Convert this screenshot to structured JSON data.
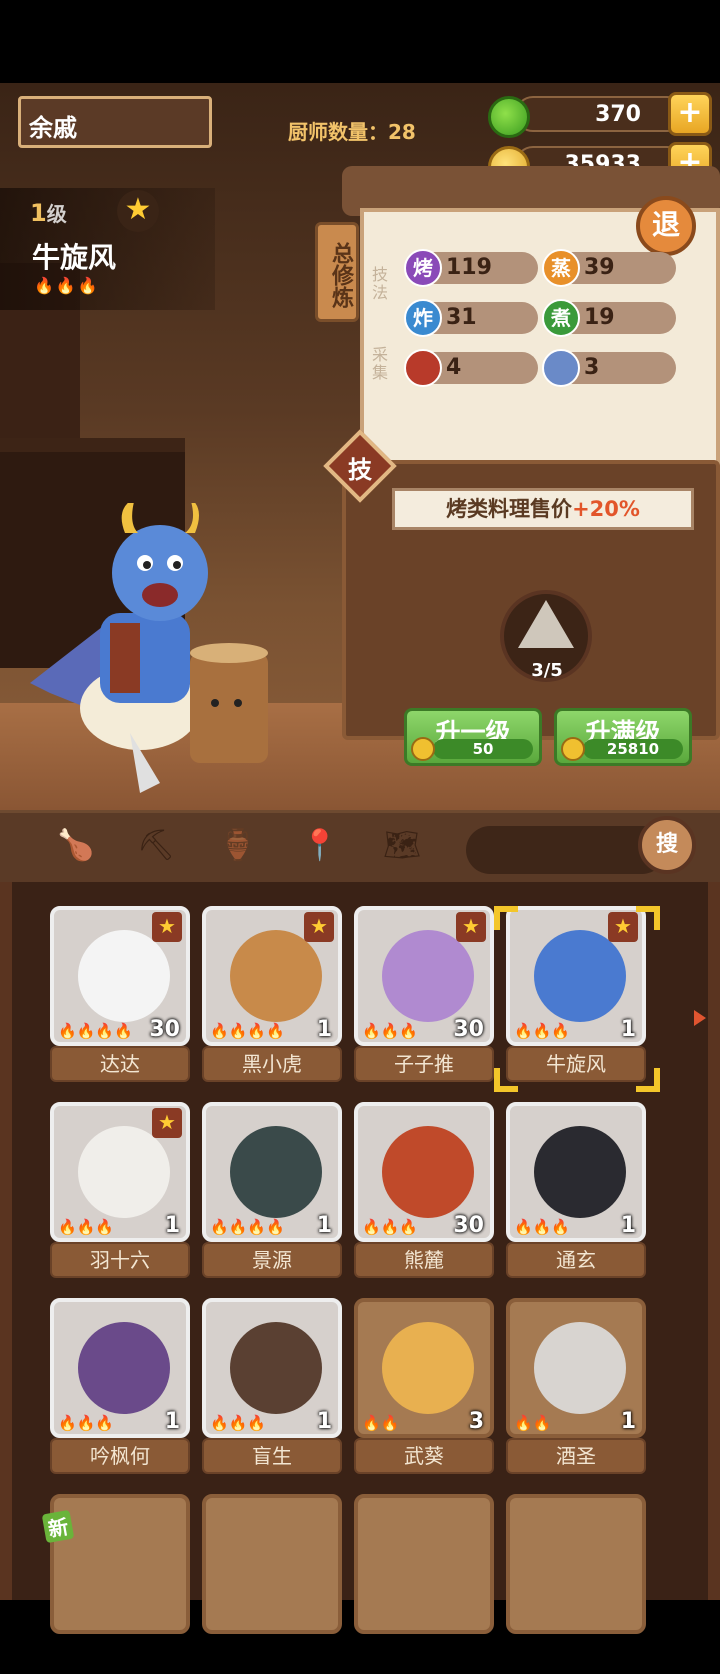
{
  "header": {
    "player_name": "余戚",
    "chef_count_label": "厨师数量：28",
    "jade": "370",
    "coins": "35933",
    "plus_label": "+"
  },
  "character": {
    "level_num": "1",
    "level_unit": "级",
    "name": "牛旋风",
    "flames": "🔥🔥🔥"
  },
  "panel": {
    "side_tag": "总修炼",
    "exit_label": "退",
    "skill_label": "技法",
    "gather_label": "采集",
    "skills": [
      {
        "icon": "烤",
        "value": "119",
        "color": "#8a4ab8"
      },
      {
        "icon": "蒸",
        "value": "39",
        "color": "#e8902a"
      },
      {
        "icon": "炸",
        "value": "31",
        "color": "#3a8ad0"
      },
      {
        "icon": "煮",
        "value": "19",
        "color": "#3a9a3a"
      }
    ],
    "gather": [
      {
        "icon": "meat-icon",
        "value": "4"
      },
      {
        "icon": "fish-icon",
        "value": "3"
      }
    ],
    "tech_label": "技",
    "bonus_text": "烤类料理售价",
    "bonus_pct": "+20%",
    "unlock_progress": "3/5",
    "upgrade_one_label": "升一级",
    "upgrade_one_cost": "50",
    "upgrade_max_label": "升满级",
    "upgrade_max_cost": "25810"
  },
  "filters": {
    "icons": [
      "drumstick-icon",
      "shovel-icon",
      "jar-icon",
      "location-icon",
      "map-question-icon"
    ],
    "search_label": "搜"
  },
  "chefs": [
    {
      "name": "达达",
      "level": "30",
      "flames": "🔥🔥🔥🔥",
      "star": true,
      "color": "#f4f4f4"
    },
    {
      "name": "黑小虎",
      "level": "1",
      "flames": "🔥🔥🔥🔥",
      "star": true,
      "color": "#c88a4a"
    },
    {
      "name": "子子推",
      "level": "30",
      "flames": "🔥🔥🔥",
      "star": true,
      "color": "#b08ad0"
    },
    {
      "name": "牛旋风",
      "level": "1",
      "flames": "🔥🔥🔥",
      "star": true,
      "color": "#4a7ad0"
    },
    {
      "name": "羽十六",
      "level": "1",
      "flames": "🔥🔥🔥",
      "star": true,
      "color": "#f0eeea"
    },
    {
      "name": "景源",
      "level": "1",
      "flames": "🔥🔥🔥🔥",
      "star": false,
      "color": "#3a4a4a"
    },
    {
      "name": "熊麓",
      "level": "30",
      "flames": "🔥🔥🔥",
      "star": false,
      "color": "#c04a2a"
    },
    {
      "name": "通玄",
      "level": "1",
      "flames": "🔥🔥🔥",
      "star": false,
      "color": "#2a2a30"
    },
    {
      "name": "吟枫何",
      "level": "1",
      "flames": "🔥🔥🔥",
      "star": false,
      "color": "#6a4a8a"
    },
    {
      "name": "盲生",
      "level": "1",
      "flames": "🔥🔥🔥",
      "star": false,
      "color": "#5a4032"
    },
    {
      "name": "武葵",
      "level": "3",
      "flames": "🔥🔥",
      "star": false,
      "color": "#e8b050"
    },
    {
      "name": "酒圣",
      "level": "1",
      "flames": "🔥🔥",
      "star": false,
      "color": "#d8d4d0"
    }
  ],
  "new_badge": "新"
}
